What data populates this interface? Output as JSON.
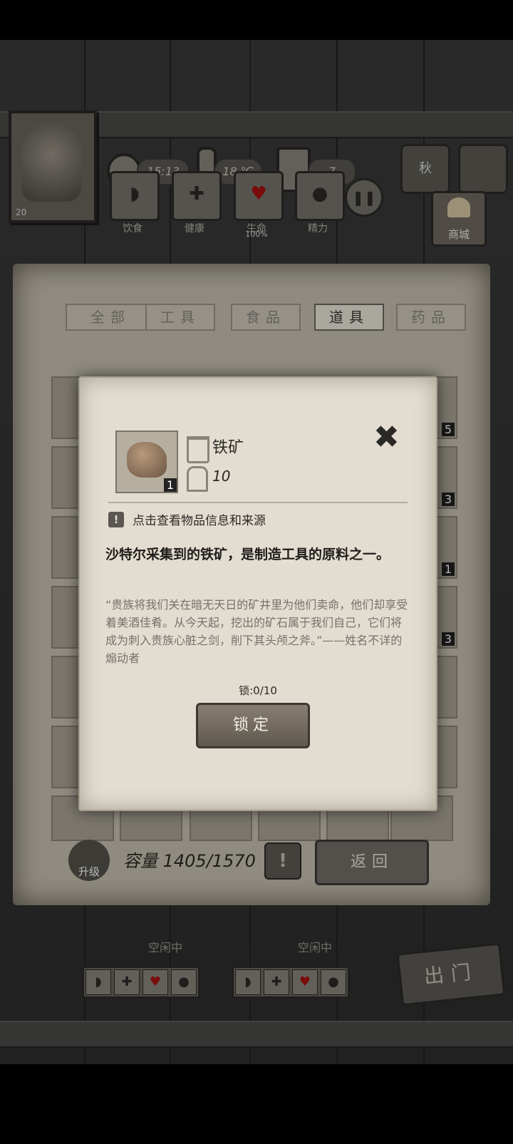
{
  "header": {
    "time": "15:13",
    "temperature": "18 ℃",
    "day": "7",
    "season": "秋",
    "portrait_level": "20"
  },
  "status_buttons": [
    {
      "icon": "stomach-icon",
      "label": "饮食"
    },
    {
      "icon": "health-cross-icon",
      "label": "健康"
    },
    {
      "icon": "heart-icon",
      "label": "生命",
      "value": "100%"
    },
    {
      "icon": "mind-icon",
      "label": "精力"
    }
  ],
  "shop": {
    "label": "商城"
  },
  "inventory": {
    "tabs": [
      "全部",
      "工具",
      "食品",
      "道具",
      "药品"
    ],
    "active_tab": "道具",
    "slot_counts": [
      "5",
      "3",
      "1",
      "3"
    ],
    "capacity_label": "容量 1405/1570",
    "upgrade_label": "升级",
    "back_label": "返回"
  },
  "team": {
    "status": [
      "空闲中",
      "空闲中"
    ]
  },
  "exit_label": "出门",
  "modal": {
    "item_name": "铁矿",
    "item_count": "1",
    "weight": "10",
    "hint": "点击查看物品信息和来源",
    "description": "沙特尔采集到的铁矿，是制造工具的原料之一。",
    "quote": "“贵族将我们关在暗无天日的矿井里为他们卖命，他们却享受着美酒佳肴。从今天起，挖出的矿石属于我们自己，它们将成为刺入贵族心脏之剑，削下其头颅之斧。”——姓名不详的煽动者",
    "lock_count": "锁:0/10",
    "lock_button": "锁定"
  }
}
